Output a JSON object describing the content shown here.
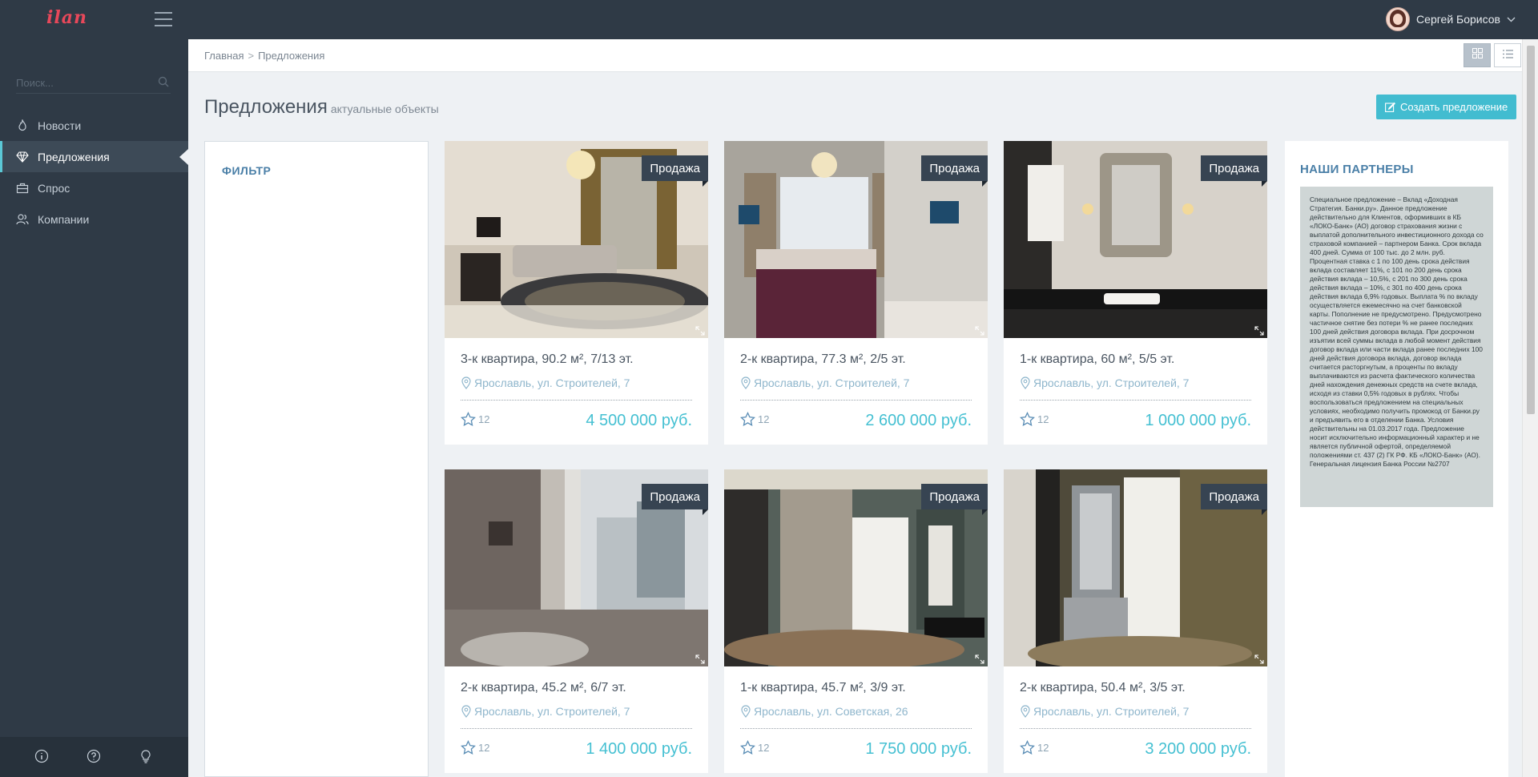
{
  "app": {
    "logo": "ilan"
  },
  "user": {
    "name": "Сергей Борисов"
  },
  "search": {
    "placeholder": "Поиск..."
  },
  "nav": {
    "items": [
      {
        "label": "Новости",
        "icon": "fire-icon"
      },
      {
        "label": "Предложения",
        "icon": "diamond-icon",
        "active": true
      },
      {
        "label": "Спрос",
        "icon": "briefcase-icon"
      },
      {
        "label": "Компании",
        "icon": "users-icon"
      }
    ]
  },
  "breadcrumb": {
    "home": "Главная",
    "sep": ">",
    "current": "Предложения"
  },
  "page": {
    "title": "Предложения",
    "subtitle": "актуальные объекты",
    "create_label": "Создать предложение"
  },
  "filter": {
    "title": "ФИЛЬТР"
  },
  "cards": [
    {
      "tag": "Продажа",
      "title": "3-к квартира, 90.2 м², 7/13 эт.",
      "address": "Ярославль, ул. Строителей, 7",
      "favorites": "12",
      "price": "4 500 000 руб."
    },
    {
      "tag": "Продажа",
      "title": "2-к квартира, 77.3 м², 2/5 эт.",
      "address": "Ярославль, ул. Строителей, 7",
      "favorites": "12",
      "price": "2 600 000 руб."
    },
    {
      "tag": "Продажа",
      "title": "1-к квартира, 60 м², 5/5 эт.",
      "address": "Ярославль, ул. Строителей, 7",
      "favorites": "12",
      "price": "1 000 000 руб."
    },
    {
      "tag": "Продажа",
      "title": "2-к квартира, 45.2 м², 6/7 эт.",
      "address": "Ярославль, ул. Строителей, 7",
      "favorites": "12",
      "price": "1 400 000 руб."
    },
    {
      "tag": "Продажа",
      "title": "1-к квартира, 45.7 м², 3/9 эт.",
      "address": "Ярославль, ул. Советская, 26",
      "favorites": "12",
      "price": "1 750 000 руб."
    },
    {
      "tag": "Продажа",
      "title": "2-к квартира, 50.4 м², 3/5 эт.",
      "address": "Ярославль, ул. Строителей, 7",
      "favorites": "12",
      "price": "3 200 000 руб."
    }
  ],
  "partners": {
    "title": "НАШИ ПАРТНЕРЫ",
    "ad_text": "Специальное предложение – Вклад «Доходная Стратегия. Банки.ру». Данное предложение действительно для Клиентов, оформивших в КБ «ЛОКО-Банк» (АО) договор страхования жизни с выплатой дополнительного инвестиционного дохода со страховой компанией – партнером Банка. Срок вклада 400 дней. Сумма от 100 тыс. до 2 млн. руб. Процентная ставка с 1 по 100 день срока действия вклада составляет 11%, с 101 по 200 день срока действия вклада – 10,5%, с 201 по 300 день срока действия вклада – 10%, с 301 по 400 день срока действия вклада 6,9% годовых. Выплата % по вкладу осуществляется ежемесячно на счет банковской карты. Пополнение не предусмотрено. Предусмотрено частичное снятие без потери % не ранее последних 100 дней действия договора вклада. При досрочном изъятии всей суммы вклада в любой момент действия договор вклада или части вклада ранее последних 100 дней действия договора вклада, договор вклада считается расторгнутым, а проценты по вкладу выплачиваются из расчета фактического количества дней нахождения денежных средств на счете вклада, исходя из ставки 0,5% годовых в рублях. Чтобы воспользоваться предложением на специальных условиях, необходимо получить промокод от Банки.ру и предъявить его в отделении Банка. Условия действительны на 01.03.2017 года. Предложение носит исключительно информационный характер и не является публичной офертой, определяемой положениями ст. 437 (2) ГК РФ. КБ «ЛОКО-Банк» (АО). Генеральная лицензия Банка России №2707"
  },
  "colors": {
    "accent": "#45c0d2",
    "sidebar": "#2f3a46",
    "tag": "#374452",
    "heading": "#4a7fa7"
  }
}
